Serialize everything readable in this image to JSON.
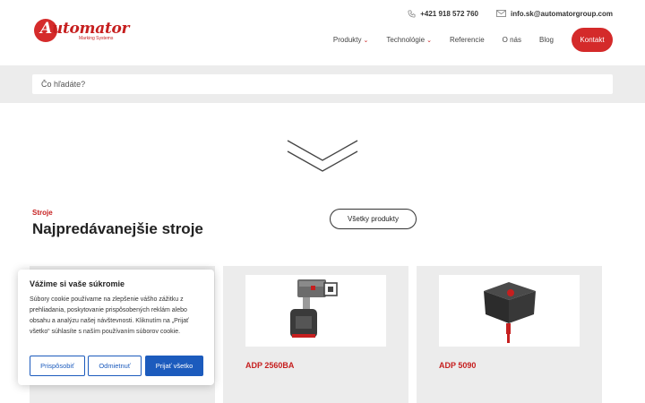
{
  "brand": {
    "logo_text_first": "A",
    "logo_text_rest": "utomator",
    "logo_subtitle": "Marking Systems"
  },
  "topbar": {
    "phone": "+421 918 572 760",
    "email": "info.sk@automatorgroup.com"
  },
  "nav": {
    "items": [
      {
        "label": "Produkty",
        "has_dropdown": true
      },
      {
        "label": "Technológie",
        "has_dropdown": true
      },
      {
        "label": "Referencie",
        "has_dropdown": false
      },
      {
        "label": "O nás",
        "has_dropdown": false
      },
      {
        "label": "Blog",
        "has_dropdown": false
      }
    ],
    "contact_label": "Kontakt"
  },
  "search": {
    "placeholder": "Čo hľadáte?"
  },
  "section": {
    "eyebrow": "Stroje",
    "title": "Najpredávanejšie stroje",
    "all_products_label": "Všetky produkty"
  },
  "products": [
    {
      "name": ""
    },
    {
      "name": "ADP 2560BA"
    },
    {
      "name": "ADP 5090"
    }
  ],
  "cookie": {
    "title": "Vážime si vaše súkromie",
    "text": "Súbory cookie používame na zlepšenie vášho zážitku z prehliadania, poskytovanie prispôsobených reklám alebo obsahu a analýzu našej návštevnosti. Kliknutím na „Prijať všetko“ súhlasíte s naším používaním súborov cookie.",
    "customize_label": "Prispôsobiť",
    "reject_label": "Odmietnuť",
    "accept_label": "Prijať všetko"
  },
  "colors": {
    "brand_red": "#d42a2a",
    "cookie_blue": "#1c5bbd",
    "band_gray": "#ececec"
  }
}
